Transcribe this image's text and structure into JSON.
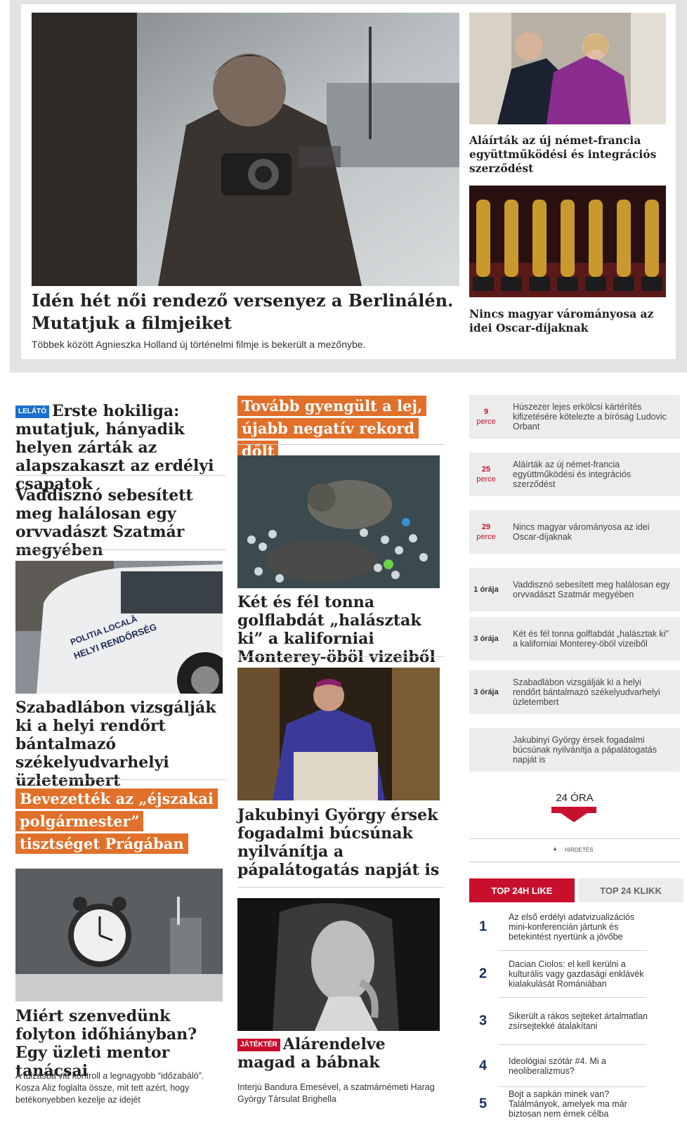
{
  "featured": {
    "main": {
      "title": "Idén hét női rendező versenyez a Berlinálén. Mutatjuk a filmjeiket",
      "subtitle": "Többek között Agnieszka Holland új történelmi filmje is bekerült a mezőnybe."
    },
    "side": [
      {
        "title": "Aláírták az új német-francia együttműködési és integrációs szerződést"
      },
      {
        "title": "Nincs magyar várományosa az idei Oscar-díjaknak"
      }
    ]
  },
  "left_column": [
    {
      "badge": "LELÁTÓ",
      "title": "Erste hokiliga: mutatjuk, hányadik helyen zárták az alapszakaszt az erdélyi csapatok"
    },
    {
      "title": "Vaddisznó sebesített meg halálosan egy orvvadászt Szatmár megyében"
    },
    {
      "title": "Szabadlábon vizsgálják ki a helyi rendőrt bántalmazó székelyudvarhelyi üzletembert",
      "image_alt": "POLITIA LOCALĂ HELYI RENDŐRSÉG"
    },
    {
      "title": "Bevezették az „éjszakai polgármester” tisztséget Prágában",
      "highlight": true
    },
    {
      "title": "Miért szenvedünk folyton időhiányban? Egy üzleti mentor tanácsai",
      "lead": "A túlzásba vitt kontroll a legnagyobb “időzabáló”. Kosza Aliz foglalta össze, mit tett azért, hogy betékonyebben kezelje az idejét"
    }
  ],
  "middle_column": [
    {
      "title": "Tovább gyengült a lej, újabb negatív rekord dőlt",
      "highlight": true
    },
    {
      "title": "Két és fél tonna golflabdát „halásztak ki” a kaliforniai Monterey-öböl vizeiből"
    },
    {
      "title": "Jakubinyi György érsek fogadalmi búcsúnak nyilvánítja a pápalátogatás napját is"
    },
    {
      "badge": "JÁTÉKTÉR",
      "title": "Alárendelve magad a bábnak",
      "lead": "Interjú Bandura Emesével, a szatmárnémeti Harag György Társulat Brighella"
    }
  ],
  "latest": [
    {
      "num": "9",
      "unit": "perce",
      "text": "Húszezer lejes erkölcsi kártérítés kifizetésére kötelezte a bíróság Ludovic Orbant"
    },
    {
      "num": "25",
      "unit": "perce",
      "text": "Aláírták az új német-francia együttműködési és integrációs szerződést"
    },
    {
      "num": "29",
      "unit": "perce",
      "text": "Nincs magyar várományosa az idei Oscar-díjaknak"
    },
    {
      "time": "1 órája",
      "text": "Vaddisznó sebesített meg halálosan egy orvvadászt Szatmár megyében"
    },
    {
      "time": "3 órája",
      "text": "Két és fél tonna golflabdát „halásztak ki” a kaliforniai Monterey-öböl vizeiből"
    },
    {
      "time": "3 órája",
      "text": "Szabadlábon vizsgálják ki a helyi rendőrt bántalmazó székelyudvarhelyi üzletembert"
    },
    {
      "time": "",
      "text": "Jakubinyi György érsek fogadalmi búcsúnak nyilvánítja a pápalátogatás napját is"
    }
  ],
  "more_label": "24 ÓRA",
  "ad_label": "HIRDETÉS",
  "tabs": {
    "active": "TOP 24H LIKE",
    "inactive": "TOP 24 KLIKK"
  },
  "top_list": [
    {
      "rank": "1",
      "text": "Az első erdélyi adatvizualizációs mini-konferencián jártunk és betekintést nyertünk a jövőbe"
    },
    {
      "rank": "2",
      "text": "Dacian Ciolos: el kell kerülni a kulturális vagy gazdasági enklávék kialakulását Romániában"
    },
    {
      "rank": "3",
      "text": "Sikerült a rákos sejteket ártalmatlan zsírsejtekké átalakítani"
    },
    {
      "rank": "4",
      "text": "Ideológiai szótár #4. Mi a neoliberalizmus?"
    },
    {
      "rank": "5",
      "text": "Bojt a sapkán minek van? Találmányok, amelyek ma már biztosan nem érnek célba"
    }
  ],
  "colors": {
    "accent_red": "#c8102e",
    "orange": "#e0702a",
    "badge_blue": "#1b6fc9",
    "navy": "#1a2f5a"
  }
}
